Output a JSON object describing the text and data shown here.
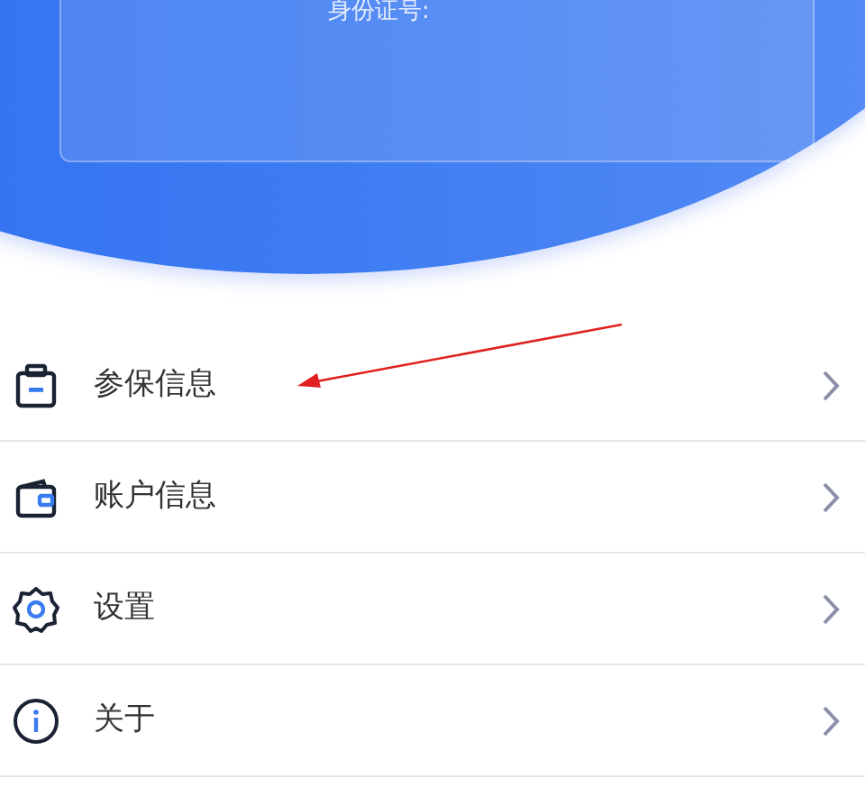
{
  "id_card": {
    "label": "身份证号:"
  },
  "menu": [
    {
      "label": "参保信息",
      "kind": "clipboard"
    },
    {
      "label": "账户信息",
      "kind": "wallet"
    },
    {
      "label": "设置",
      "kind": "gear"
    },
    {
      "label": "关于",
      "kind": "info"
    }
  ]
}
